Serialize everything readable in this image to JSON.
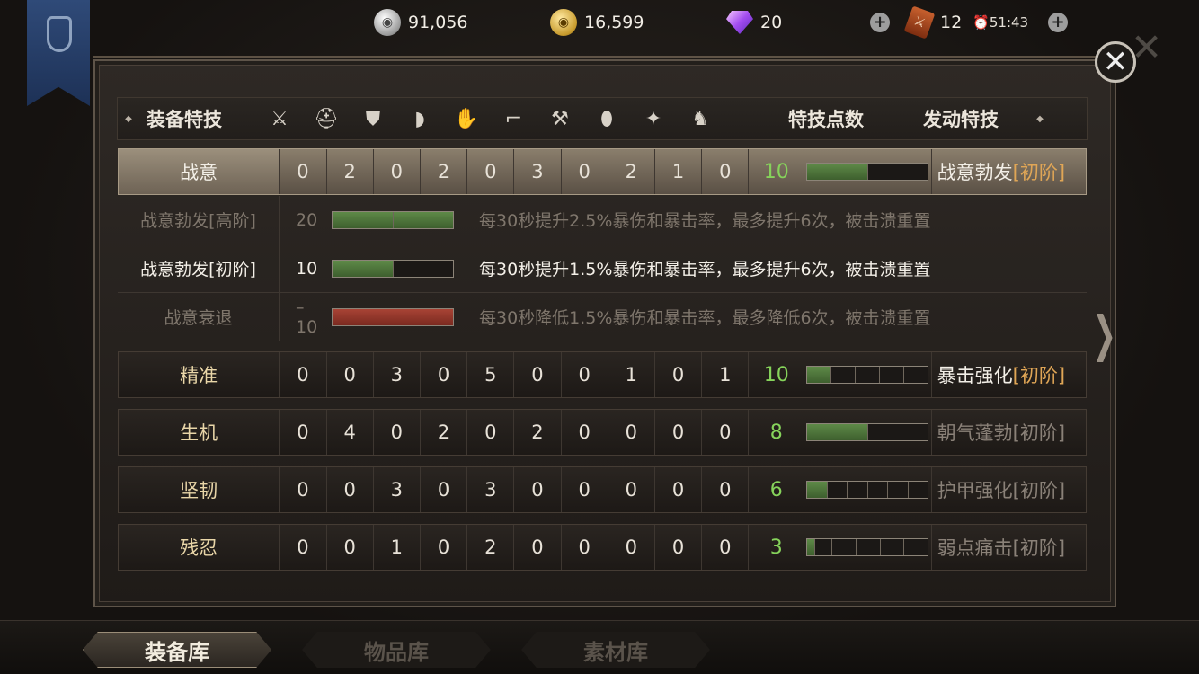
{
  "topbar": {
    "silver": "91,056",
    "gold": "16,599",
    "gems": "20",
    "tickets": "12",
    "timer": "51:43"
  },
  "table": {
    "header": {
      "col_name": "装备特技",
      "col_points": "特技点数",
      "col_active": "发动特技",
      "slot_icons": [
        "sword-icon",
        "helmet-icon",
        "chest-armor-icon",
        "shoulder-icon",
        "glove-icon",
        "boot-icon",
        "weapon-mace-icon",
        "shield-icon",
        "wolf-crest-icon",
        "horse-icon"
      ]
    },
    "rows": [
      {
        "name": "战意",
        "values": [
          "0",
          "2",
          "0",
          "2",
          "0",
          "3",
          "0",
          "2",
          "1",
          "0"
        ],
        "points": "10",
        "fill_segments": 2,
        "total_segments": 5,
        "active_name": "战意勃发",
        "active_tier": "[初阶]",
        "selected": true
      },
      {
        "name": "精准",
        "values": [
          "0",
          "0",
          "3",
          "0",
          "5",
          "0",
          "0",
          "1",
          "0",
          "1"
        ],
        "points": "10",
        "fill_segments": 1,
        "total_segments": 5,
        "active_name": "暴击强化",
        "active_tier": "[初阶]"
      },
      {
        "name": "生机",
        "values": [
          "0",
          "4",
          "0",
          "2",
          "0",
          "2",
          "0",
          "0",
          "0",
          "0"
        ],
        "points": "8",
        "fill_segments": 2,
        "total_segments": 3,
        "active_name": "朝气蓬勃",
        "active_tier": "[初阶]"
      },
      {
        "name": "坚韧",
        "values": [
          "0",
          "0",
          "3",
          "0",
          "3",
          "0",
          "0",
          "0",
          "0",
          "0"
        ],
        "points": "6",
        "fill_segments": 1,
        "total_segments": 6,
        "active_name": "护甲强化",
        "active_tier": "[初阶]"
      },
      {
        "name": "残忍",
        "values": [
          "0",
          "0",
          "1",
          "0",
          "2",
          "0",
          "0",
          "0",
          "0",
          "0"
        ],
        "points": "3",
        "fill_segments": 0.3,
        "total_segments": 5,
        "active_name": "弱点痛击",
        "active_tier": "[初阶]"
      }
    ],
    "sub_rows": [
      {
        "name": "战意勃发[高阶]",
        "value": "20",
        "desc": "每30秒提升2.5%暴伤和暴击率，最多提升6次，被击溃重置"
      },
      {
        "name": "战意勃发[初阶]",
        "value": "10",
        "desc": "每30秒提升1.5%暴伤和暴击率，最多提升6次，被击溃重置"
      },
      {
        "name": "战意衰退",
        "value": "–10",
        "desc": "每30秒降低1.5%暴伤和暴击率，最多降低6次，被击溃重置"
      }
    ]
  },
  "tabs": [
    "装备库",
    "物品库",
    "素材库"
  ]
}
